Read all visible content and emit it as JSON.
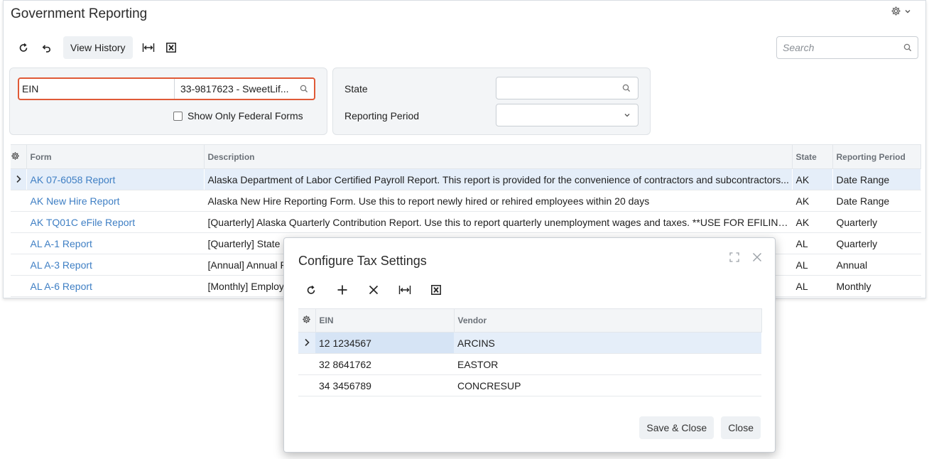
{
  "page": {
    "title": "Government Reporting"
  },
  "toolbar": {
    "view_history": "View History"
  },
  "search": {
    "placeholder": "Search"
  },
  "filters": {
    "ein_label": "EIN",
    "ein_value": "33-9817623 - SweetLif...",
    "federal_only_label": "Show Only Federal Forms",
    "state_label": "State",
    "state_value": "",
    "period_label": "Reporting Period",
    "period_value": ""
  },
  "grid": {
    "columns": [
      "Form",
      "Description",
      "State",
      "Reporting Period"
    ],
    "rows": [
      {
        "form": "AK 07-6058 Report",
        "description": "Alaska Department of Labor Certified Payroll Report. This report is provided for the convenience of contractors and subcontractors...",
        "state": "AK",
        "period": "Date Range"
      },
      {
        "form": "AK New Hire Report",
        "description": "Alaska New Hire Reporting Form. Use this to report newly hired or rehired employees within 20 days",
        "state": "AK",
        "period": "Date Range"
      },
      {
        "form": "AK TQ01C eFile Report",
        "description": "[Quarterly] Alaska Quarterly Contribution Report. Use this to report quarterly unemployment wages and taxes. **USE FOR EFILING...",
        "state": "AK",
        "period": "Quarterly"
      },
      {
        "form": "AL A-1 Report",
        "description": "[Quarterly] State of",
        "state": "AL",
        "period": "Quarterly"
      },
      {
        "form": "AL A-3 Report",
        "description": "[Annual] Annual Re",
        "state": "AL",
        "period": "Annual"
      },
      {
        "form": "AL A-6 Report",
        "description": "[Monthly] Employ",
        "state": "AL",
        "period": "Monthly"
      }
    ]
  },
  "dialog": {
    "title": "Configure Tax Settings",
    "columns": [
      "EIN",
      "Vendor"
    ],
    "rows": [
      {
        "ein": "12 1234567",
        "vendor": "ARCINS"
      },
      {
        "ein": "32 8641762",
        "vendor": "EASTOR"
      },
      {
        "ein": "34 3456789",
        "vendor": "CONCRESUP"
      }
    ],
    "save_close": "Save & Close",
    "close": "Close"
  }
}
